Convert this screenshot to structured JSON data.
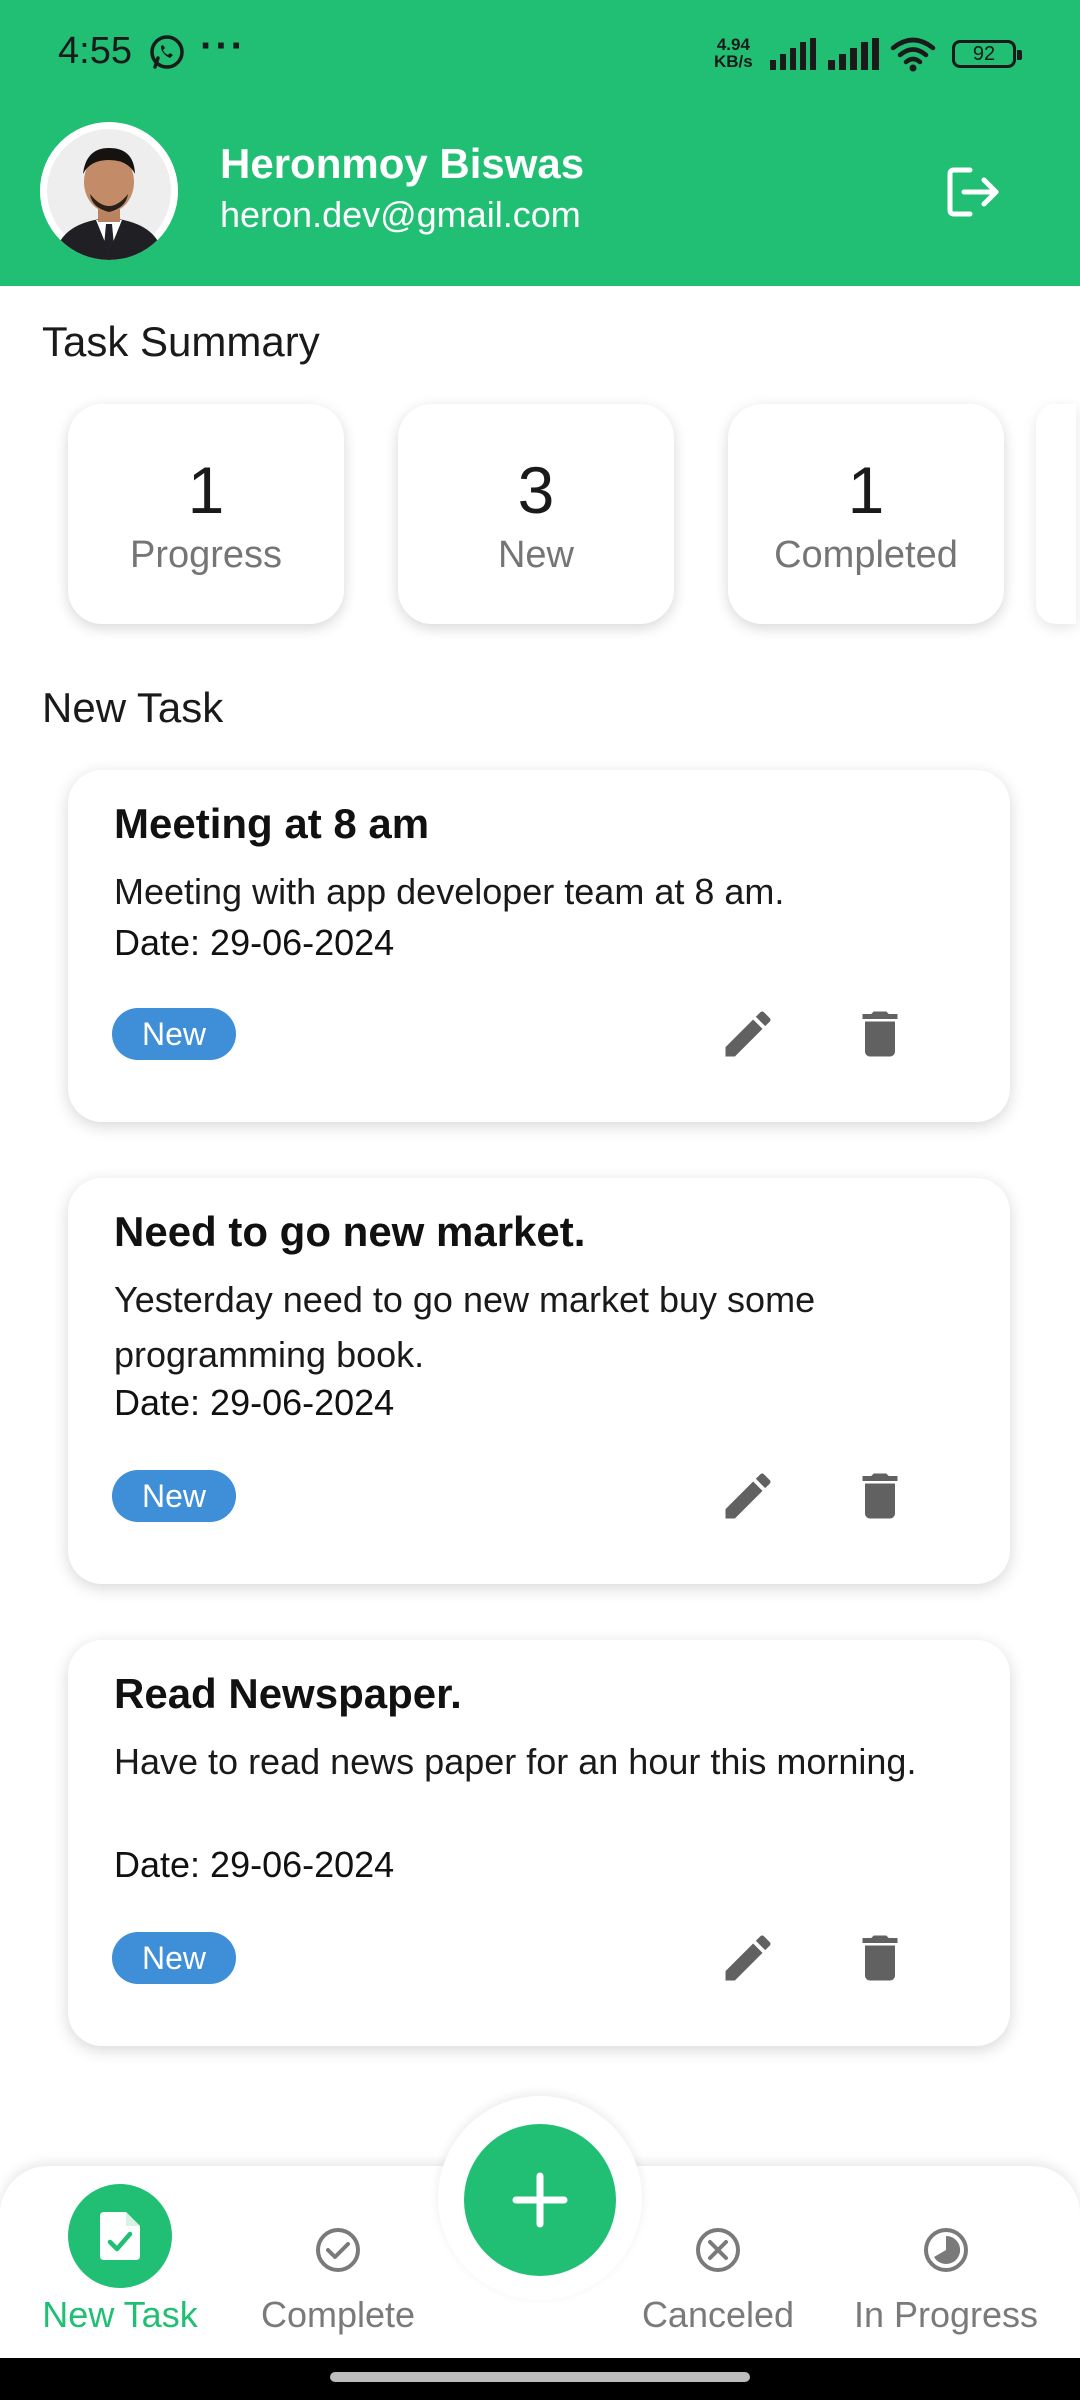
{
  "status_bar": {
    "time": "4:55",
    "dots": "···",
    "net_speed_value": "4.94",
    "net_speed_unit": "KB/s",
    "battery": "92"
  },
  "profile": {
    "name": "Heronmoy Biswas",
    "email": "heron.dev@gmail.com"
  },
  "summary": {
    "title": "Task Summary",
    "cards": [
      {
        "count": "1",
        "label": "Progress"
      },
      {
        "count": "3",
        "label": "New"
      },
      {
        "count": "1",
        "label": "Completed"
      }
    ]
  },
  "tasks_section": {
    "title": "New Task",
    "tasks": [
      {
        "title": "Meeting at 8 am",
        "description": "Meeting with app developer team at 8 am.",
        "date": "Date: 29-06-2024",
        "status": "New"
      },
      {
        "title": "Need to go new market.",
        "description": "Yesterday need to go new market buy some programming book.",
        "date": "Date: 29-06-2024",
        "status": "New"
      },
      {
        "title": "Read Newspaper.",
        "description": "Have to read news paper for an hour this morning.",
        "date": "Date: 29-06-2024",
        "status": "New"
      }
    ]
  },
  "bottom_nav": {
    "items": [
      {
        "label": "New Task",
        "icon": "document-check-icon",
        "active": true
      },
      {
        "label": "Complete",
        "icon": "check-circle-icon",
        "active": false
      },
      {
        "label": "Canceled",
        "icon": "cancel-circle-icon",
        "active": false
      },
      {
        "label": "In Progress",
        "icon": "progress-circle-icon",
        "active": false
      }
    ],
    "fab_icon": "plus-icon"
  },
  "colors": {
    "primary": "#21bf73",
    "badge": "#3f8ed8",
    "icon_gray": "#616161",
    "label_gray": "#757575"
  }
}
